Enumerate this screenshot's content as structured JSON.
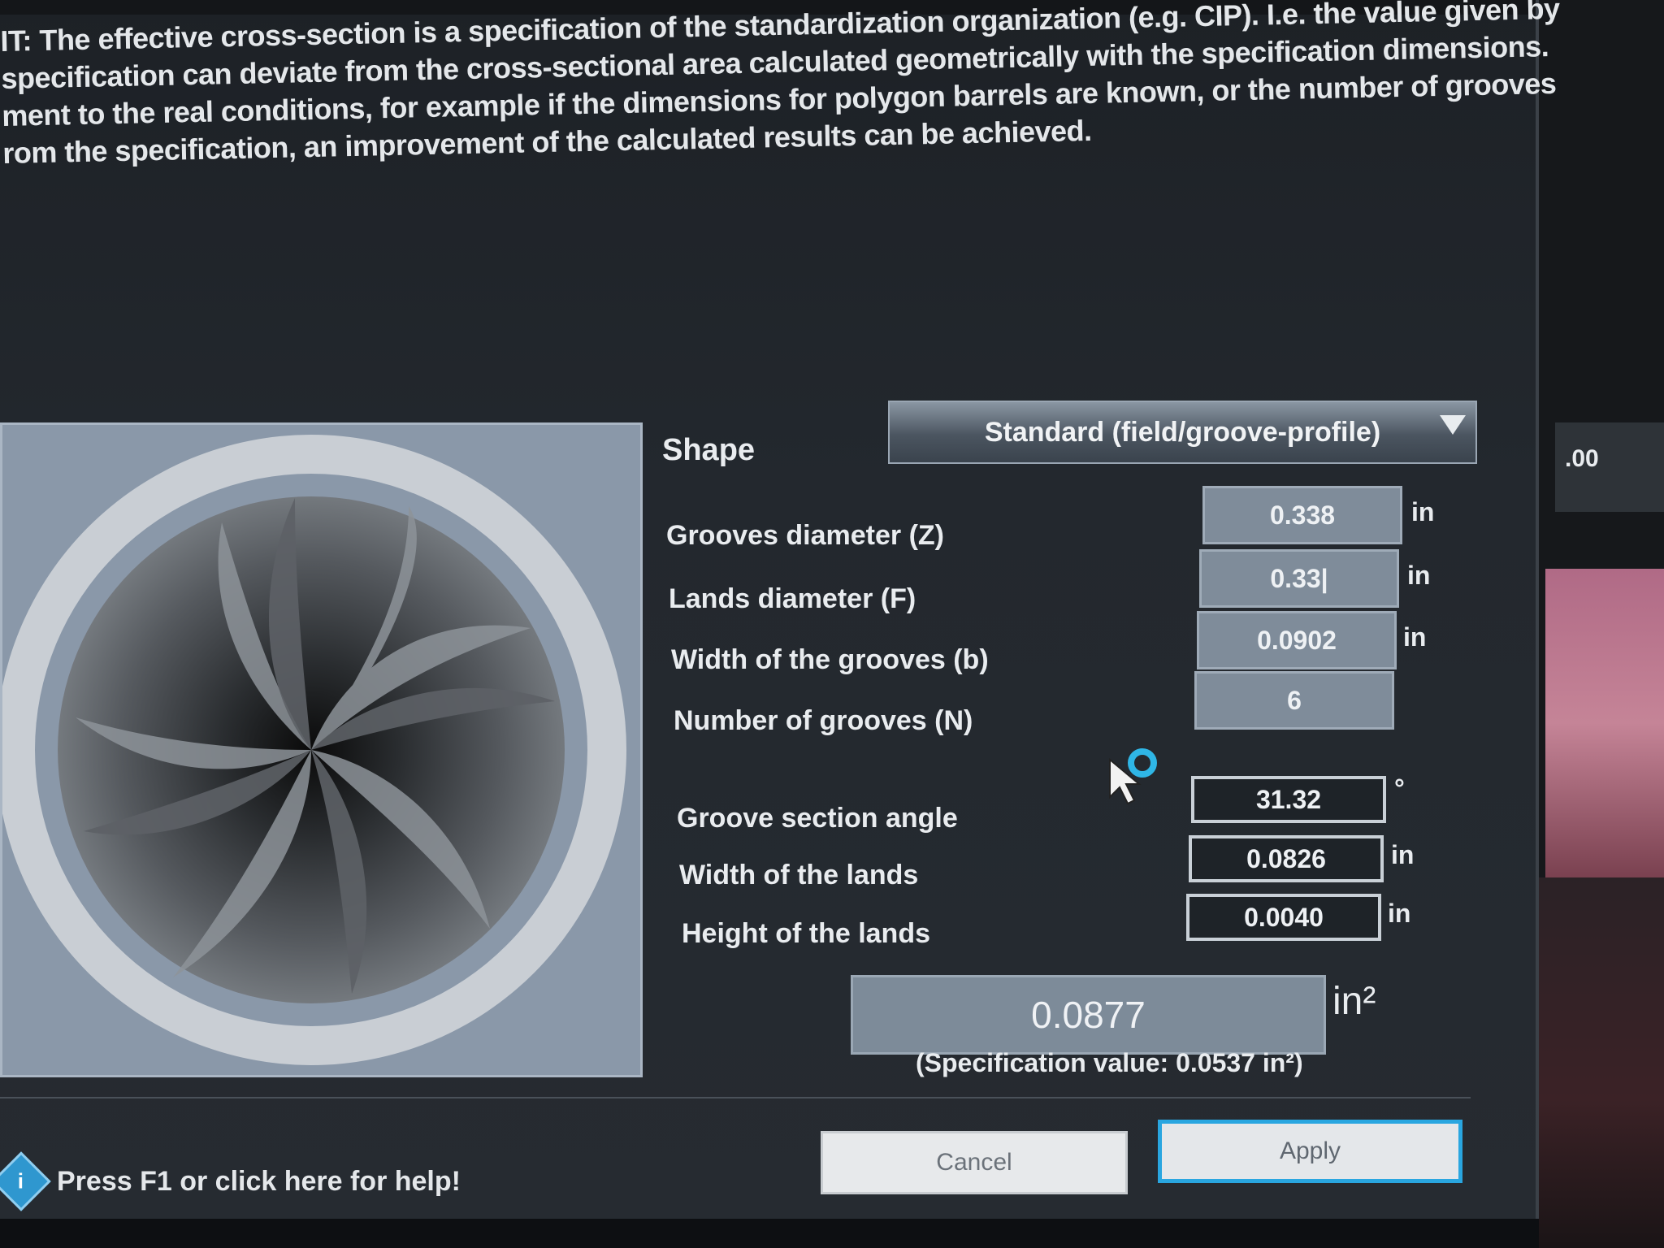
{
  "note": {
    "lines": [
      "IT: The effective cross-section is a specification of the standardization organization (e.g. CIP). I.e. the value given by",
      "specification can deviate from the cross-sectional area calculated geometrically with the specification dimensions.",
      "ment to the real conditions, for example if the dimensions for polygon barrels are known, or the number of grooves",
      "rom the specification, an improvement of the calculated results can be achieved."
    ]
  },
  "form": {
    "shape_label": "Shape",
    "shape_value": "Standard (field/groove-profile)",
    "grooves_diameter_label": "Grooves diameter (Z)",
    "grooves_diameter_value": "0.338",
    "lands_diameter_label": "Lands diameter (F)",
    "lands_diameter_value": "0.33|",
    "width_grooves_label": "Width of the grooves (b)",
    "width_grooves_value": "0.0902",
    "number_grooves_label": "Number of grooves (N)",
    "number_grooves_value": "6",
    "groove_angle_label": "Groove section angle",
    "groove_angle_value": "31.32",
    "groove_angle_unit": "°",
    "width_lands_label": "Width of the lands",
    "width_lands_value": "0.0826",
    "height_lands_label": "Height of the lands",
    "height_lands_value": "0.0040",
    "unit_in": "in",
    "result_value": "0.0877",
    "result_unit": "in²",
    "spec_value": "(Specification value: 0.0537 in²)"
  },
  "buttons": {
    "cancel": "Cancel",
    "apply": "Apply"
  },
  "help": {
    "text": "Press F1 or click here for help!",
    "icon": "info-icon"
  },
  "background": {
    "side_value": ".00"
  },
  "colors": {
    "accent": "#29a6e0",
    "cursor_ring": "#2fb6e6"
  }
}
